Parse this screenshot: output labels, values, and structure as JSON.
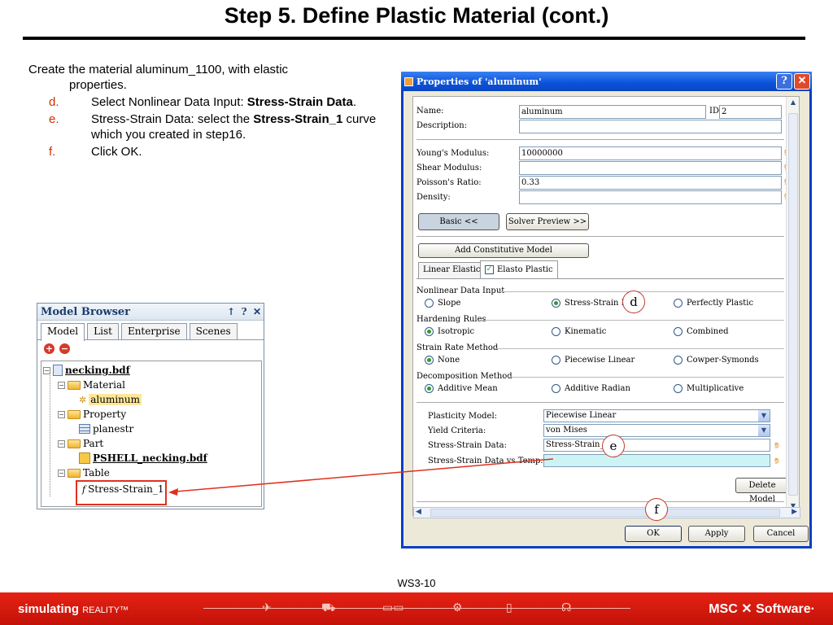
{
  "title": "Step 5. Define Plastic Material (cont.)",
  "instructions": {
    "intro": "Create the material aluminum_1100, with elastic",
    "intro_cont": "properties.",
    "steps": [
      {
        "letter": "d.",
        "pre": "Select Nonlinear Data Input: ",
        "bold": "Stress-Strain Data",
        "post": "."
      },
      {
        "letter": "e.",
        "pre": "Stress-Strain Data: select the ",
        "bold": "Stress-Strain_1",
        "post": " curve which you created in step16."
      },
      {
        "letter": "f.",
        "pre": "Click OK.",
        "bold": "",
        "post": ""
      }
    ]
  },
  "model_browser": {
    "title": "Model Browser",
    "pin": "↑",
    "help": "?",
    "close": "✕",
    "tabs": [
      "Model",
      "List",
      "Enterprise",
      "Scenes"
    ],
    "tree": {
      "root": "necking.bdf",
      "material": "Material",
      "aluminum": "aluminum",
      "property": "Property",
      "planestr": "planestr",
      "part": "Part",
      "pshell": "PSHELL_necking.bdf",
      "table": "Table",
      "curve": "Stress-Strain_1"
    }
  },
  "dialog": {
    "title": "Properties of 'aluminum'",
    "help": "?",
    "close": "✕",
    "name_label": "Name:",
    "name_value": "aluminum",
    "id_label": "ID:",
    "id_value": "2",
    "description_label": "Description:",
    "youngs_label": "Young's Modulus:",
    "youngs_value": "10000000",
    "shear_label": "Shear Modulus:",
    "poisson_label": "Poisson's Ratio:",
    "poisson_value": "0.33",
    "density_label": "Density:",
    "basic_button": "Basic <<",
    "solver_preview_button": "Solver Preview >>",
    "add_constitutive_button": "Add Constitutive Model",
    "tab_linear": "Linear Elastic",
    "tab_elasto": "Elasto Plastic",
    "groups": {
      "nonlinear": {
        "label": "Nonlinear Data Input",
        "options": [
          "Slope",
          "Stress-Strain Data",
          "Perfectly Plastic"
        ],
        "selected": "Stress-Strain Data"
      },
      "hardening": {
        "label": "Hardening Rules",
        "options": [
          "Isotropic",
          "Kinematic",
          "Combined"
        ],
        "selected": "Isotropic"
      },
      "strain_rate": {
        "label": "Strain Rate Method",
        "options": [
          "None",
          "Piecewise Linear",
          "Cowper-Symonds"
        ],
        "selected": "None"
      },
      "decomposition": {
        "label": "Decomposition Method",
        "options": [
          "Additive Mean",
          "Additive Radian",
          "Multiplicative"
        ],
        "selected": "Additive Mean"
      }
    },
    "plasticity_label": "Plasticity Model:",
    "plasticity_value": "Piecewise Linear",
    "yield_label": "Yield Criteria:",
    "yield_value": "von Mises",
    "ss_label": "Stress-Strain Data:",
    "ss_value": "Stress-Strain_1",
    "ss_temp_label": "Stress-Strain Data vs Temp.:",
    "delete_model_button": "Delete Model",
    "ok_button": "OK",
    "apply_button": "Apply",
    "cancel_button": "Cancel"
  },
  "callouts": {
    "d": "d",
    "e": "e",
    "f": "f"
  },
  "footer": {
    "label": "WS3-10",
    "brand_bold": "simulating",
    "brand_light": "REALITY™",
    "company": "MSC",
    "company2": "Software·"
  },
  "colors": {
    "accent_red": "#e52214",
    "dialog_blue": "#0a52d8",
    "step_letter": "#cc3300"
  }
}
